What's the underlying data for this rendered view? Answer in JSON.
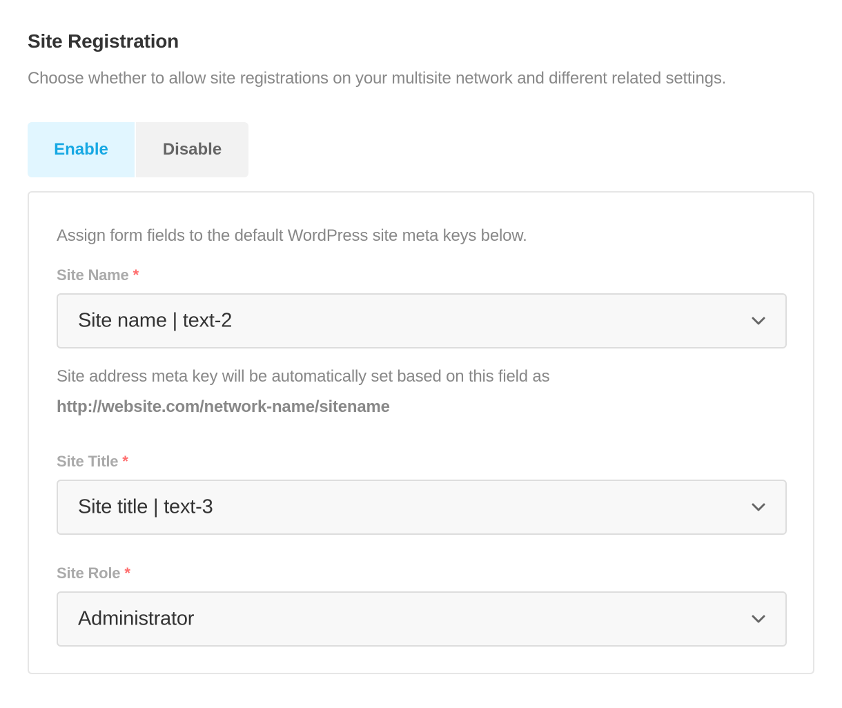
{
  "section": {
    "title": "Site Registration",
    "description": "Choose whether to allow site registrations on your multisite network and different related settings."
  },
  "toggle": {
    "enable_label": "Enable",
    "disable_label": "Disable",
    "selected": "Enable",
    "active_color": "#17a8e3"
  },
  "panel": {
    "intro": "Assign form fields to the default WordPress site meta keys below.",
    "site_name": {
      "label": "Site Name",
      "required_mark": "*",
      "value": "Site name | text-2",
      "help": "Site address meta key will be automatically set based on this field as",
      "help_url": "http://website.com/network-name/sitename"
    },
    "site_title": {
      "label": "Site Title",
      "required_mark": "*",
      "value": "Site title | text-3"
    },
    "site_role": {
      "label": "Site Role",
      "required_mark": "*",
      "value": "Administrator"
    },
    "required_color": "#ff6d6d",
    "chevron_icon": "chevron-down-icon"
  }
}
